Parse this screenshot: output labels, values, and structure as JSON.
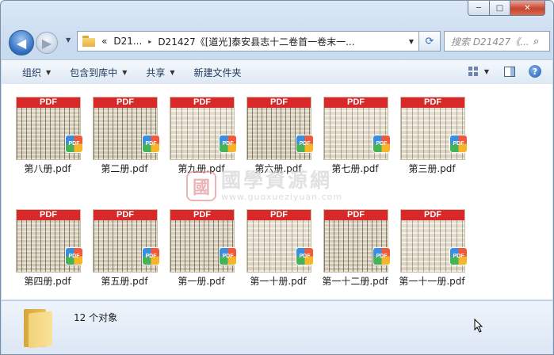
{
  "window": {
    "caption_min": "─",
    "caption_max": "□",
    "caption_close": "✕"
  },
  "nav": {
    "back_glyph": "◀",
    "forward_glyph": "▶",
    "history_glyph": "▼",
    "address": {
      "prefix": "«",
      "crumbs": [
        "D21...",
        "D21427《[道光]泰安县志十二卷首一卷末一..."
      ],
      "separator": "▸",
      "dropdown": "▼"
    },
    "refresh_glyph": "⟳",
    "search": {
      "placeholder": "搜索 D21427《...",
      "icon": "search-icon"
    }
  },
  "toolbar": {
    "items": [
      {
        "label": "组织",
        "arrow": "▼"
      },
      {
        "label": "包含到库中",
        "arrow": "▼"
      },
      {
        "label": "共享",
        "arrow": "▼"
      },
      {
        "label": "新建文件夹",
        "arrow": ""
      }
    ],
    "view_arrow": "▼",
    "help": "?"
  },
  "files": [
    {
      "name": "第八册.pdf",
      "band": "PDF",
      "badge": "PDF"
    },
    {
      "name": "第二册.pdf",
      "band": "PDF",
      "badge": "PDF"
    },
    {
      "name": "第九册.pdf",
      "band": "PDF",
      "badge": "PDF"
    },
    {
      "name": "第六册.pdf",
      "band": "PDF",
      "badge": "PDF"
    },
    {
      "name": "第七册.pdf",
      "band": "PDF",
      "badge": "PDF"
    },
    {
      "name": "第三册.pdf",
      "band": "PDF",
      "badge": "PDF"
    },
    {
      "name": "第四册.pdf",
      "band": "PDF",
      "badge": "PDF"
    },
    {
      "name": "第五册.pdf",
      "band": "PDF",
      "badge": "PDF"
    },
    {
      "name": "第一册.pdf",
      "band": "PDF",
      "badge": "PDF"
    },
    {
      "name": "第一十册.pdf",
      "band": "PDF",
      "badge": "PDF"
    },
    {
      "name": "第一十二册.pdf",
      "band": "PDF",
      "badge": "PDF"
    },
    {
      "name": "第一十一册.pdf",
      "band": "PDF",
      "badge": "PDF"
    }
  ],
  "watermark": {
    "seal": "國",
    "text": "國學資源網",
    "url": "www.guoxueziyuan.com"
  },
  "status": {
    "count": "12 个对象"
  },
  "colors": {
    "pdf_band": "#d8282a",
    "toolbar_text": "#1e395b"
  }
}
